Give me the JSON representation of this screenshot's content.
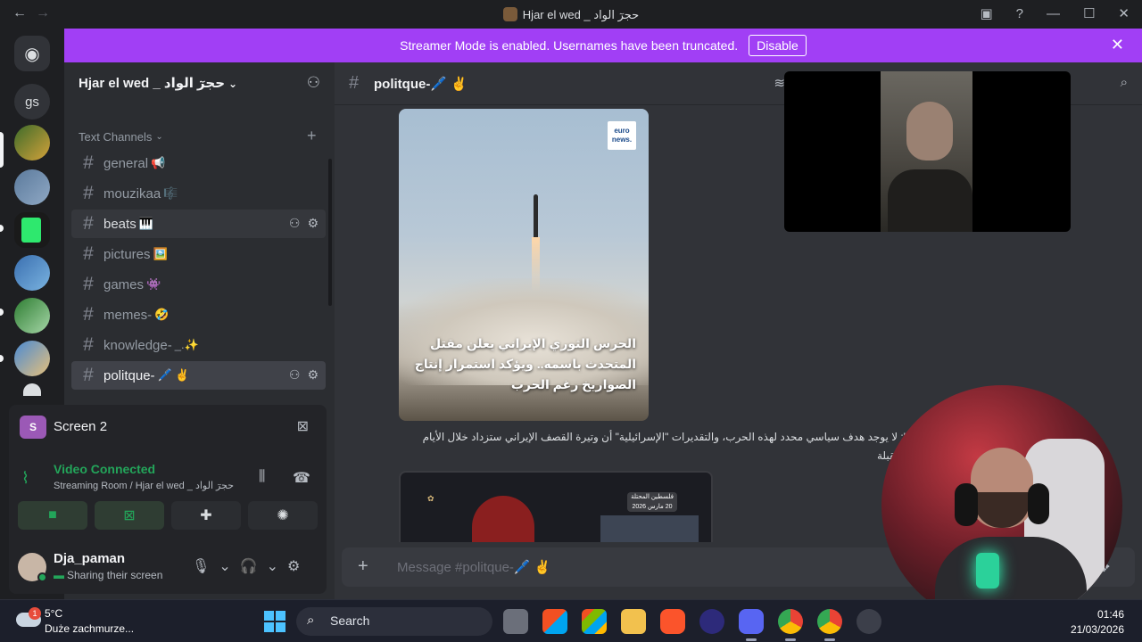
{
  "titlebar": {
    "back": "←",
    "forward": "→",
    "title": "Hjar el wed _ حجرٓ الواد"
  },
  "banner": {
    "message": "Streamer Mode is enabled. Usernames have been truncated.",
    "disable_label": "Disable",
    "color": "#a13ff5"
  },
  "rail": {
    "dm_label": "gs"
  },
  "server": {
    "name": "Hjar el wed _ حجرٓ الواد",
    "category": "Text Channels",
    "channels": [
      {
        "name": "general",
        "emoji": "📢"
      },
      {
        "name": "mouzikaa",
        "emoji": "🎼"
      },
      {
        "name": "beats",
        "emoji": "🎹"
      },
      {
        "name": "pictures",
        "emoji": "🖼️"
      },
      {
        "name": "games",
        "emoji": "👾"
      },
      {
        "name": "memes-",
        "emoji": "🤣"
      },
      {
        "name": "knowledge-",
        "emoji": "_.✨"
      },
      {
        "name": "politque-",
        "emoji": "🖊️ ✌️"
      }
    ]
  },
  "screen_share": {
    "avatar_letter": "S",
    "label": "Screen 2"
  },
  "voice": {
    "status": "Video Connected",
    "location": "Streaming Room / Hjar el wed _ حجرٓ الواد"
  },
  "user": {
    "name": "Dja_paman",
    "status": "Sharing their screen"
  },
  "chat": {
    "channel_title": "politque-🖊️ ✌️",
    "image_logo": "euro news.",
    "image_caption": "الحرس الثوري الإيراني يعلن مقتل المتحدث باسمه.. ويؤكد استمرار إنتاج الصواريخ رغم الحرب",
    "message_text": "\": لا يوجد هدف سياسي محدد لهذه الحرب، والتقديرات \"الإسرائيلية\" أن وتيرة القصف الإيراني ستزداد خلال الأيام المقبلة",
    "image2_tag": "فلسطين المحتلة 20 مارس 2026",
    "composer_placeholder": "Message #politque-🖊️ ✌️"
  },
  "taskbar": {
    "weather_badge": "1",
    "temperature": "5°C",
    "condition": "Duże zachmurze...",
    "search_label": "Search",
    "time": "01:46",
    "date": "21/03/2026"
  }
}
